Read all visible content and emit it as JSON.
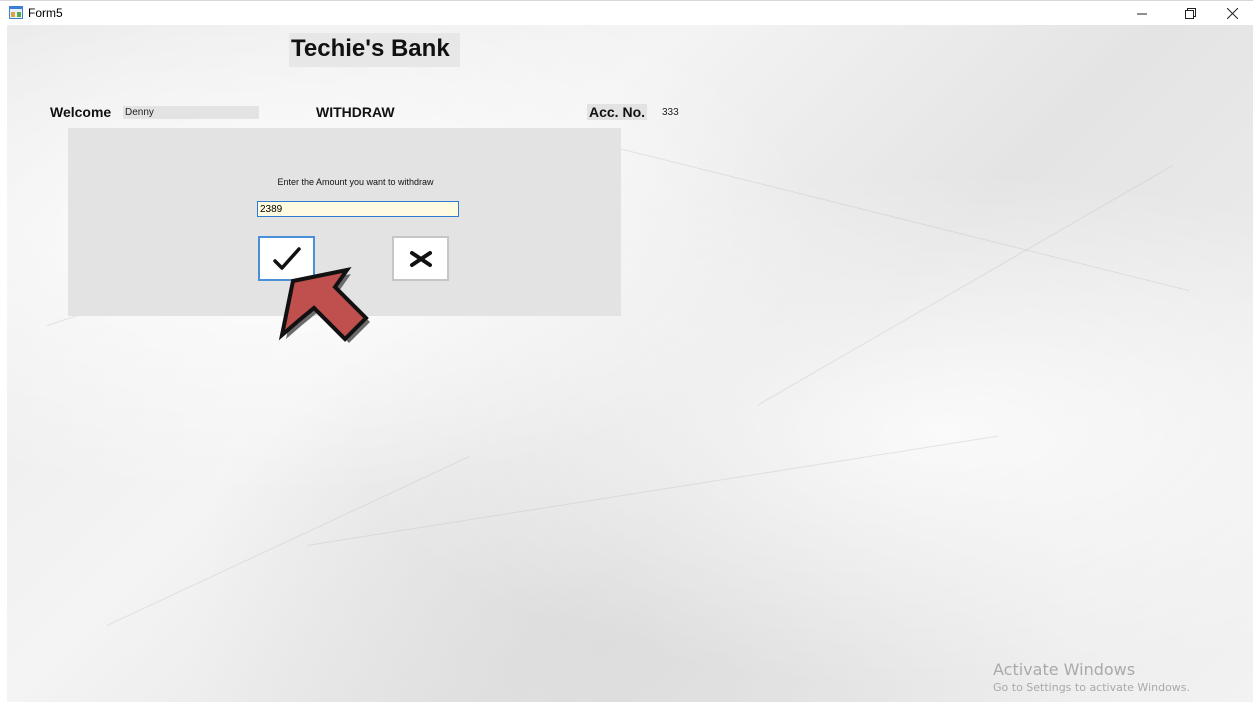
{
  "window": {
    "title": "Form5",
    "controls": [
      "minimize-icon",
      "restore-icon",
      "close-icon"
    ]
  },
  "header": {
    "bank_name": "Techie's Bank",
    "welcome_label": "Welcome",
    "user_name": "Denny",
    "section_title": "WITHDRAW",
    "account_label": "Acc. No.",
    "account_number": "333"
  },
  "withdraw_panel": {
    "prompt": "Enter the Amount you want to withdraw",
    "amount_value": "2389",
    "confirm_icon": "checkmark-icon",
    "cancel_icon": "close-x-icon"
  },
  "annotation": {
    "pointer": "red-arrow-icon",
    "pointer_color": "#c0504d"
  },
  "watermark": {
    "title": "Activate Windows",
    "subtitle": "Go to Settings to activate Windows."
  },
  "colors": {
    "panel": "#e3e3e3",
    "input_bg": "#fffbe0",
    "focus_border": "#4a90d9"
  }
}
